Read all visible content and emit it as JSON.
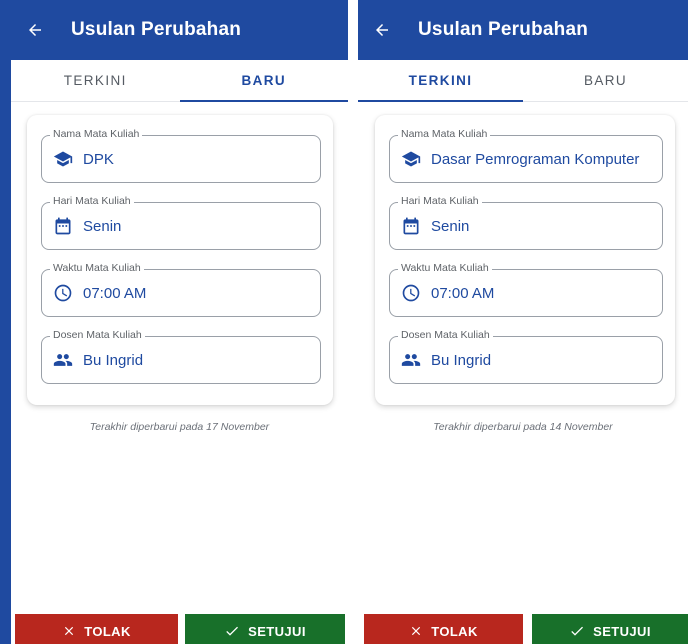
{
  "app": {
    "title": "Usulan Perubahan"
  },
  "colors": {
    "primary": "#1f4aa0",
    "reject": "#b8271e",
    "approve": "#18702a"
  },
  "tabs": {
    "latest": "TERKINI",
    "new": "BARU"
  },
  "labels": {
    "course_name": "Nama Mata Kuliah",
    "course_day": "Hari Mata Kuliah",
    "course_time": "Waktu Mata Kuliah",
    "course_lecturer": "Dosen Mata Kuliah"
  },
  "icons": {
    "back": "arrow-left-icon",
    "course_name": "graduation-cap-icon",
    "course_day": "calendar-icon",
    "course_time": "clock-icon",
    "course_lecturer": "people-icon",
    "reject": "close-icon",
    "approve": "check-icon"
  },
  "panels": [
    {
      "active_tab": "BARU",
      "course_name": "DPK",
      "course_day": "Senin",
      "course_time": "07:00 AM",
      "course_lecturer": "Bu Ingrid",
      "updated": "Terakhir diperbarui pada 17 November"
    },
    {
      "active_tab": "TERKINI",
      "course_name": "Dasar Pemrograman Komputer",
      "course_day": "Senin",
      "course_time": "07:00 AM",
      "course_lecturer": "Bu Ingrid",
      "updated": "Terakhir diperbarui pada 14 November"
    }
  ],
  "actions": {
    "reject": "TOLAK",
    "approve": "SETUJUI"
  }
}
